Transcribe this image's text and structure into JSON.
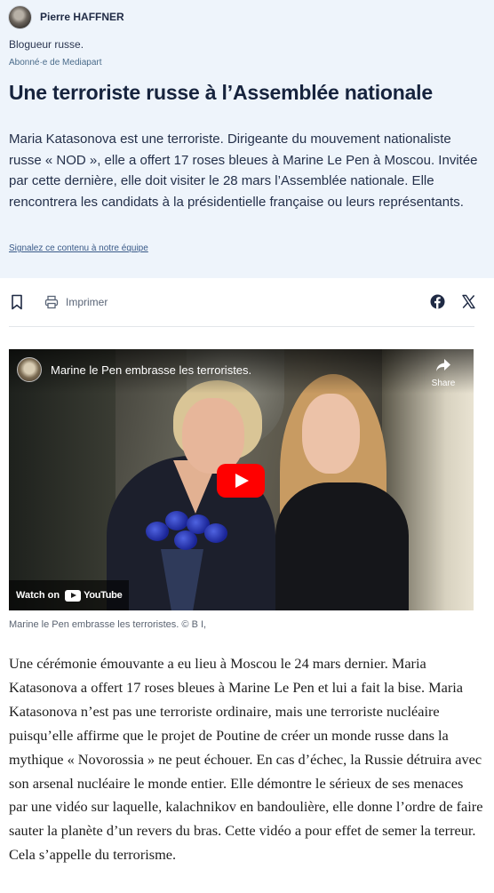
{
  "author": {
    "name": "Pierre HAFFNER",
    "bio": "Blogueur russe.",
    "subscription": "Abonné·e de Mediapart"
  },
  "article": {
    "title": "Une terroriste russe à l’Assemblée nationale",
    "lead": "Maria Katasonova est une terroriste. Dirigeante du mouvement nationaliste russe « NOD », elle a offert 17 roses bleues à Marine Le Pen à Moscou. Invitée par cette dernière, elle doit visiter le 28 mars l’Assemblée nationale. Elle rencontrera les candidats à la présidentielle française ou leurs représentants.",
    "report_link": "Signalez ce contenu à notre équipe",
    "body": "Une cérémonie émouvante a eu lieu à Moscou le 24 mars dernier. Maria Katasonova a offert 17 roses bleues à Marine Le Pen et lui a fait la bise. Maria Katasonova n’est pas une terroriste ordinaire, mais une terroriste nucléaire puisqu’elle affirme que le projet de Poutine de créer un monde russe dans la mythique « Novorossia » ne peut échouer. En cas d’échec, la Russie détruira avec son arsenal nucléaire le monde entier. Elle démontre le sérieux de ses menaces par une vidéo sur laquelle, kalachnikov en bandoulière,  elle donne l’ordre de faire sauter la planète d’un revers du bras. Cette vidéo a pour effet de semer la terreur. Cela s’appelle du terrorisme."
  },
  "toolbar": {
    "print_label": "Imprimer",
    "icons": [
      "bookmark-icon",
      "printer-icon",
      "facebook-icon",
      "x-icon"
    ]
  },
  "video": {
    "title": "Marine le Pen embrasse les terroristes.",
    "share_label": "Share",
    "watch_on_label": "Watch on",
    "platform": "YouTube",
    "play_color": "#ff0000",
    "caption": "Marine le Pen embrasse les terroristes. © B I,"
  },
  "colors": {
    "hero_background": "#eef4fb",
    "title": "#16233d",
    "link": "#3a5a88"
  }
}
